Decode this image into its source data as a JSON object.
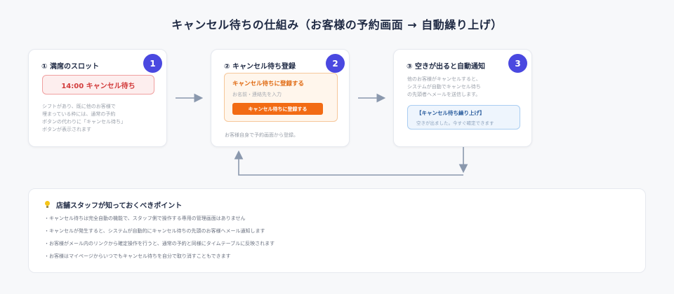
{
  "title": "キャンセル待ちの仕組み（お客様の予約画面 → 自動繰り上げ）",
  "steps": [
    {
      "number": "1",
      "title": "① 満席のスロット",
      "slot_label": "14:00 キャンセル待ち",
      "description": "シフトがあり、既に他のお客様で\n埋まっている枠には、通常の予約\nボタンの代わりに「キャンセル待ち」\nボタンが表示されます"
    },
    {
      "number": "2",
      "title": "② キャンセル待ち登録",
      "form_title": "キャンセル待ちに登録する",
      "form_field": "お名前・連絡先を入力",
      "form_button": "キャンセル待ちに登録する",
      "description": "お客様自身で予約画面から登録。"
    },
    {
      "number": "3",
      "title": "③ 空きが出ると自動通知",
      "description": "他のお客様がキャンセルすると、\nシステムが自動でキャンセル待ち\nの先頭者へメールを送信します。",
      "notice_title": "【キャンセル待ち繰り上げ】",
      "notice_text": "空きが出ました。今すぐ確定できます"
    }
  ],
  "points": {
    "heading": "店舗スタッフが知っておくべきポイント",
    "icon": "lightbulb-icon",
    "items": [
      "・キャンセル待ちは完全自動の機能で、スタッフ側で操作する専用の管理画面はありません",
      "・キャンセルが発生すると、システムが自動的にキャンセル待ちの先頭のお客様へメール通知します",
      "・お客様がメール内のリンクから確定操作を行うと、通常の予約と同様にタイムテーブルに反映されます",
      "・お客様はマイページからいつでもキャンセル待ちを自分で取り消すこともできます"
    ]
  },
  "colors": {
    "badge": "#4a48e0",
    "slot_red": "#d23b3b",
    "form_orange": "#f26b14",
    "notice_blue": "#2a5d9e",
    "arrow": "#8a98ad"
  }
}
